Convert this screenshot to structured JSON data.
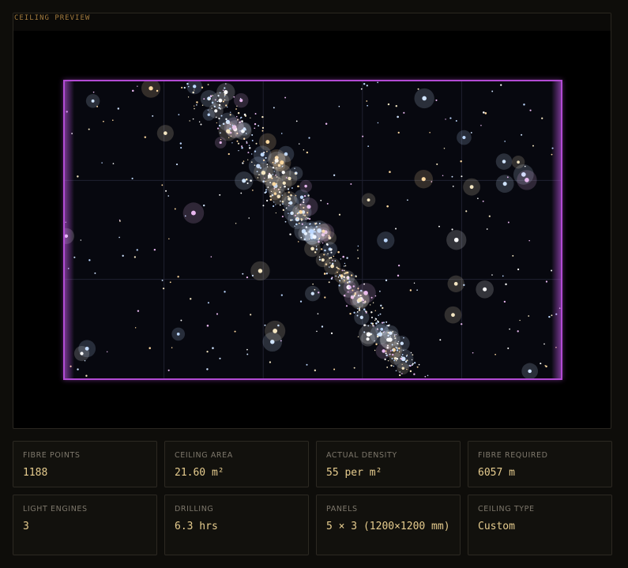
{
  "preview": {
    "title": "CEILING PREVIEW",
    "grid": {
      "cols": 5,
      "rows": 3
    },
    "colors": {
      "background": "#07080f",
      "frame": "#b24bd4",
      "grid": "#1f2130"
    }
  },
  "stats": [
    {
      "label": "FIBRE POINTS",
      "value": "1188"
    },
    {
      "label": "CEILING AREA",
      "value": "21.60 m²"
    },
    {
      "label": "ACTUAL DENSITY",
      "value": "55 per m²"
    },
    {
      "label": "FIBRE REQUIRED",
      "value": "6057 m"
    },
    {
      "label": "LIGHT ENGINES",
      "value": "3"
    },
    {
      "label": "DRILLING",
      "value": "6.3 hrs"
    },
    {
      "label": "PANELS",
      "value": "5 × 3 (1200×1200 mm)"
    },
    {
      "label": "CEILING TYPE",
      "value": "Custom"
    }
  ],
  "colors": {
    "accent": "#e6cc8e",
    "label": "#7d776b",
    "card_border": "#2c2922"
  }
}
